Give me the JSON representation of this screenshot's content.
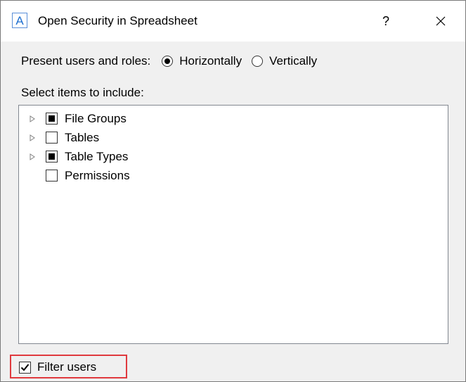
{
  "dialog": {
    "app_icon_letter": "A",
    "title": "Open Security in Spreadsheet",
    "help_label": "?",
    "close_icon": "close-icon"
  },
  "present": {
    "label": "Present users and roles:",
    "options": [
      {
        "label": "Horizontally",
        "selected": true
      },
      {
        "label": "Vertically",
        "selected": false
      }
    ]
  },
  "items": {
    "label": "Select items to include:",
    "tree": [
      {
        "label": "File Groups",
        "state": "partial",
        "expandable": true
      },
      {
        "label": "Tables",
        "state": "unchecked",
        "expandable": true
      },
      {
        "label": "Table Types",
        "state": "partial",
        "expandable": true
      },
      {
        "label": "Permissions",
        "state": "unchecked",
        "expandable": false
      }
    ]
  },
  "filter": {
    "label": "Filter users",
    "checked": true,
    "highlight_color": "#e03a3e"
  },
  "colors": {
    "accent": "#1e6fd0",
    "dialog_background": "#f0f0f0"
  }
}
